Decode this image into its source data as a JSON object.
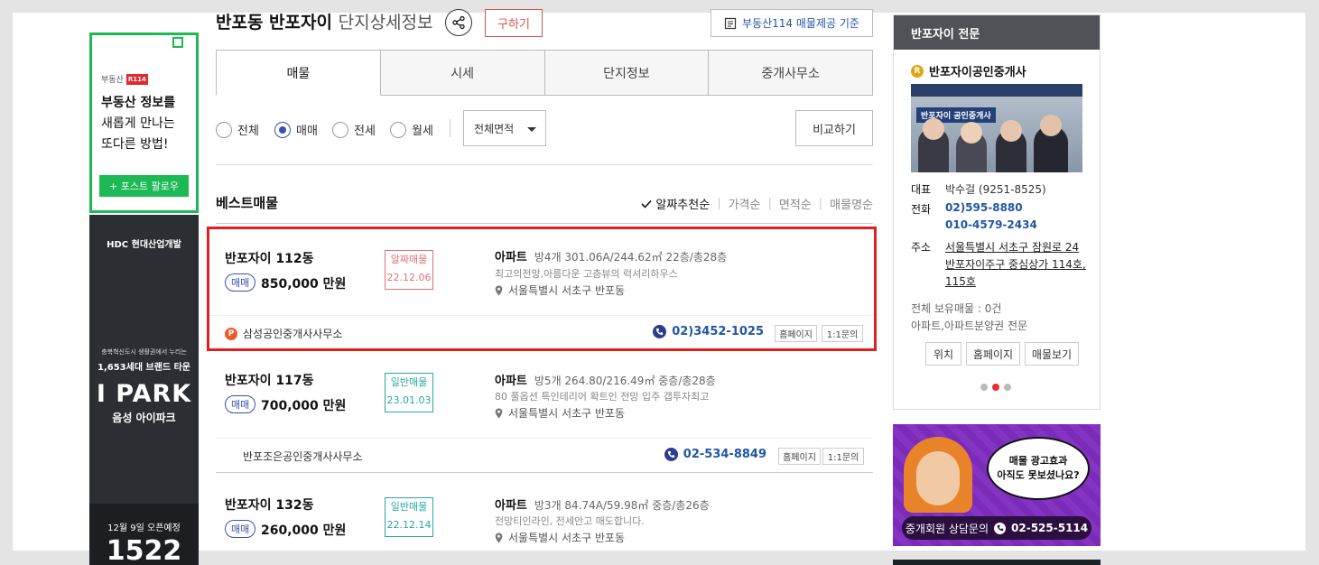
{
  "header": {
    "title_main": "반포동 반포자이",
    "title_sub": "단지상세정보",
    "buy_button": "구하기",
    "source_button": "부동산114 매물제공 기준"
  },
  "tabs": [
    {
      "label": "매물"
    },
    {
      "label": "시세"
    },
    {
      "label": "단지정보"
    },
    {
      "label": "중개사무소"
    }
  ],
  "filters": {
    "options": [
      "전체",
      "매매",
      "전세",
      "월세"
    ],
    "selected": "매매",
    "area_select": "전체면적",
    "compare_button": "비교하기"
  },
  "best": {
    "title": "베스트매물",
    "sorts": [
      "알짜추천순",
      "가격순",
      "면적순",
      "매물명순"
    ],
    "active_sort": "알짜추천순"
  },
  "listings": [
    {
      "name": "반포자이 112동",
      "trade": "매매",
      "price": "850,000 만원",
      "tag_label": "알짜매물",
      "tag_date": "22.12.06",
      "type": "아파트",
      "spec": "방4개  301.06A/244.62㎡  22층/총28층",
      "desc": "최고의전망,아름다운 고층뷰의 럭셔리하우스",
      "address": "서울특별시 서초구 반포동",
      "agency": "삼성공인중개사사무소",
      "phone": "02)3452-1025",
      "homepage": "홈페이지",
      "inquiry": "1:1문의"
    },
    {
      "name": "반포자이 117동",
      "trade": "매매",
      "price": "700,000 만원",
      "tag_label": "일반매물",
      "tag_date": "23.01.03",
      "type": "아파트",
      "spec": "방5개  264.80/216.49㎡  중층/총28층",
      "desc": "80 풀옵션 특인테리어 확트인 전망 입주 갭투자최고",
      "address": "서울특별시 서초구 반포동",
      "agency": "반포조은공인중개사사무소",
      "phone": "02-534-8849",
      "homepage": "홈페이지",
      "inquiry": "1:1문의"
    },
    {
      "name": "반포자이 132동",
      "trade": "매매",
      "price": "260,000 만원",
      "tag_label": "일반매물",
      "tag_date": "22.12.14",
      "type": "아파트",
      "spec": "방3개  84.74A/59.98㎡  중층/총26층",
      "desc": "전망티인라인, 전세안고 매도합니다.",
      "address": "서울특별시 서초구 반포동"
    }
  ],
  "panel": {
    "title": "반포자이 전문",
    "office_name": "반포자이공인중개사",
    "photo_banner": "반포자이 공인중개사",
    "rep_label": "대표",
    "rep_value": "박수걸 (9251-8525)",
    "phone_label": "전화",
    "phone1": "02)595-8880",
    "phone2": "010-4579-2434",
    "addr_label": "주소",
    "addr_line1": "서울특별시 서초구 잠원로 24",
    "addr_line2": "반포자이주구 중심상가 114호,",
    "addr_line3": "115호",
    "holdings": "전체 보유매물 : 0건",
    "specialty": "아파트,아파트분양권 전문",
    "buttons": [
      "위치",
      "홈페이지",
      "매물보기"
    ]
  },
  "ads": {
    "left_top": {
      "brand": "부동산",
      "brand_badge": "R114",
      "line1": "부동산 정보를",
      "line2": "새롭게 만나는",
      "line3": "또다른 방법!",
      "button": "+ 포스트 팔로우"
    },
    "left_bottom": {
      "company": "HDC 현대산업개발",
      "small1": "충북혁신도시 생활권에서 누리는",
      "small2": "1,653세대 브랜드 타운",
      "brand": "I PARK",
      "project": "음성 아이파크",
      "open": "12월 9일 오픈예정",
      "number": "1522"
    },
    "right": {
      "bubble_line1": "매물 광고효과",
      "bubble_line2": "아직도 못보셨나요?",
      "cta_label": "중개회원 상담문의",
      "cta_phone": "02-525-5114"
    }
  },
  "colors": {
    "accent_blue": "#2255a4",
    "highlight_red": "#e02020",
    "ad_green": "#1db954",
    "ad_purple": "#7a2bb8"
  }
}
